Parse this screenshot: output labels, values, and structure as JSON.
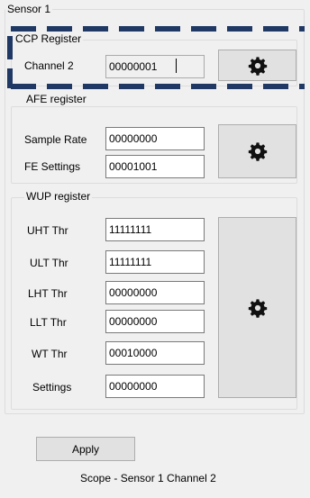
{
  "sensor_panel": {
    "title": "Sensor 1"
  },
  "ccp": {
    "title": "CCP Register",
    "channel_label": "Channel 2",
    "channel_value": "00000001"
  },
  "afe": {
    "title": "AFE register",
    "sample_rate_label": "Sample Rate",
    "sample_rate_value": "00000000",
    "fe_settings_label": "FE Settings",
    "fe_settings_value": "00001001"
  },
  "wup": {
    "title": "WUP register",
    "rows": [
      {
        "label": "UHT Thr",
        "value": "11111111"
      },
      {
        "label": "ULT Thr",
        "value": "11111111"
      },
      {
        "label": "LHT Thr",
        "value": "00000000"
      },
      {
        "label": "LLT Thr",
        "value": "00000000"
      },
      {
        "label": "WT Thr",
        "value": "00010000"
      },
      {
        "label": "Settings",
        "value": "00000000"
      }
    ]
  },
  "footer": {
    "apply_label": "Apply",
    "scope_text": "Scope - Sensor 1 Channel 2"
  },
  "icons": {
    "settings_button_icon": "gear-icon"
  },
  "colors": {
    "highlight_dash": "#1f3864",
    "window_bg": "#f0f0f0"
  }
}
